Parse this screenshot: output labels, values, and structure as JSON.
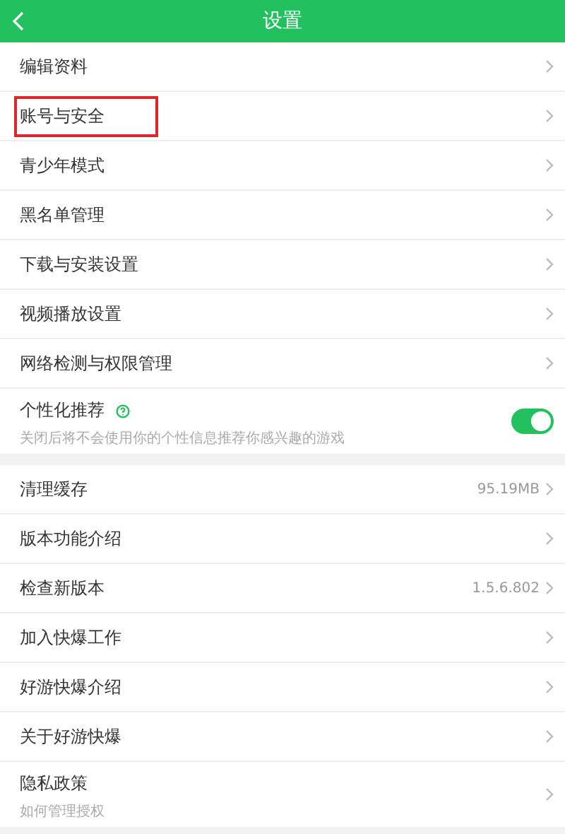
{
  "header": {
    "title": "设置"
  },
  "groups": [
    {
      "items": [
        {
          "kind": "link",
          "label": "编辑资料",
          "highlighted": false
        },
        {
          "kind": "link",
          "label": "账号与安全",
          "highlighted": true
        },
        {
          "kind": "link",
          "label": "青少年模式",
          "highlighted": false
        },
        {
          "kind": "link",
          "label": "黑名单管理",
          "highlighted": false
        },
        {
          "kind": "link",
          "label": "下载与安装设置",
          "highlighted": false
        },
        {
          "kind": "link",
          "label": "视频播放设置",
          "highlighted": false
        },
        {
          "kind": "link",
          "label": "网络检测与权限管理",
          "highlighted": false
        },
        {
          "kind": "toggle",
          "label": "个性化推荐",
          "subtitle": "关闭后将不会使用你的个性信息推荐你感兴趣的游戏",
          "on": true,
          "highlighted": false
        }
      ]
    },
    {
      "items": [
        {
          "kind": "link",
          "label": "清理缓存",
          "value": "95.19MB",
          "highlighted": false
        },
        {
          "kind": "link",
          "label": "版本功能介绍",
          "highlighted": false
        },
        {
          "kind": "link",
          "label": "检查新版本",
          "value": "1.5.6.802",
          "highlighted": false
        },
        {
          "kind": "link",
          "label": "加入快爆工作",
          "highlighted": false
        },
        {
          "kind": "link",
          "label": "好游快爆介绍",
          "highlighted": false
        },
        {
          "kind": "link",
          "label": "关于好游快爆",
          "highlighted": false
        },
        {
          "kind": "link",
          "label": "隐私政策",
          "subtitle": "如何管理授权",
          "highlighted": false
        }
      ]
    }
  ]
}
